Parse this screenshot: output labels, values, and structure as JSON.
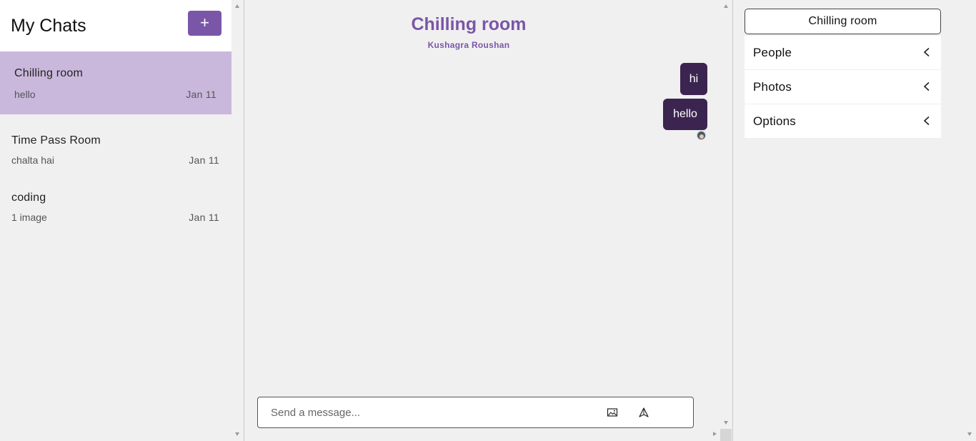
{
  "sidebar": {
    "title": "My Chats",
    "new_chat_label": "+",
    "chats": [
      {
        "name": "Chilling room",
        "preview": "hello",
        "date": "Jan 11",
        "active": true
      },
      {
        "name": "Time Pass Room",
        "preview": "chalta hai",
        "date": "Jan 11",
        "active": false
      },
      {
        "name": "coding",
        "preview": "1 image",
        "date": "Jan 11",
        "active": false
      }
    ]
  },
  "chat": {
    "room_title": "Chilling room",
    "room_subtitle": "Kushagra Roushan",
    "messages": [
      {
        "text": "hi",
        "sender": "me"
      },
      {
        "text": "hello",
        "sender": "me"
      }
    ],
    "composer": {
      "placeholder": "Send a message...",
      "image_icon": "image-icon",
      "send_icon": "send-icon"
    }
  },
  "details": {
    "title": "Chilling room",
    "sections": [
      {
        "label": "People",
        "icon": "chevron-left-icon"
      },
      {
        "label": "Photos",
        "icon": "chevron-left-icon"
      },
      {
        "label": "Options",
        "icon": "chevron-left-icon"
      }
    ]
  },
  "colors": {
    "accent": "#7a56a8",
    "active_chat_bg": "#c9b8dc",
    "message_bubble": "#3b2550",
    "background": "#f0f0f0"
  }
}
